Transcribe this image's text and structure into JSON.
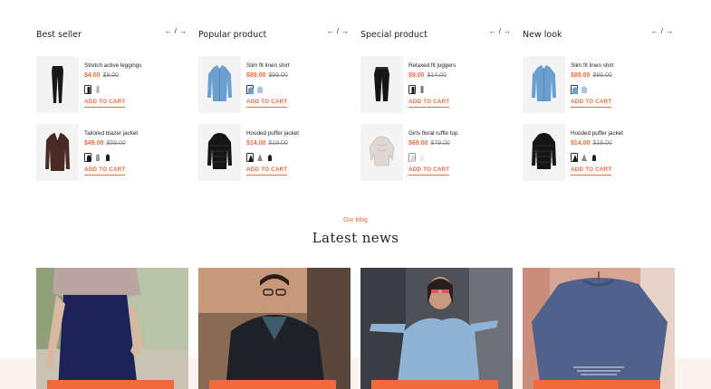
{
  "arrows": {
    "prev": "←",
    "sep": "/",
    "next": "→"
  },
  "add_to_cart": "ADD TO CART",
  "columns": [
    {
      "title": "Best seller",
      "products": [
        {
          "name": "Stretch active leggings",
          "price": "$4.00",
          "old_price": "$9.00",
          "icon": "leggings-icon"
        },
        {
          "name": "Tailored blazer jacket",
          "price": "$49.00",
          "old_price": "$59.00",
          "icon": "blazer-icon"
        }
      ]
    },
    {
      "title": "Popular product",
      "products": [
        {
          "name": "Slim fit linen shirt",
          "price": "$89.00",
          "old_price": "$99.00",
          "icon": "shirt-icon"
        },
        {
          "name": "Hooded puffer jacket",
          "price": "$14.00",
          "old_price": "$19.00",
          "icon": "puffer-jacket-icon"
        }
      ]
    },
    {
      "title": "Special product",
      "products": [
        {
          "name": "Relaxed fit joggers",
          "price": "$9.00",
          "old_price": "$14.00",
          "icon": "joggers-icon"
        },
        {
          "name": "Girls floral ruffle top",
          "price": "$69.00",
          "old_price": "$79.00",
          "icon": "ruffle-top-icon"
        }
      ]
    },
    {
      "title": "New look",
      "products": [
        {
          "name": "Slim fit linen shirt",
          "price": "$89.00",
          "old_price": "$99.00",
          "icon": "shirt-icon"
        },
        {
          "name": "Hooded puffer jacket",
          "price": "$14.00",
          "old_price": "$19.00",
          "icon": "puffer-jacket-icon"
        }
      ]
    }
  ],
  "blog": {
    "eyebrow": "Our blog",
    "title": "Latest news"
  },
  "colors": {
    "accent": "#f06a3d",
    "background_band": "#faf3ee",
    "thumb_bg": "#f4f4f4"
  }
}
